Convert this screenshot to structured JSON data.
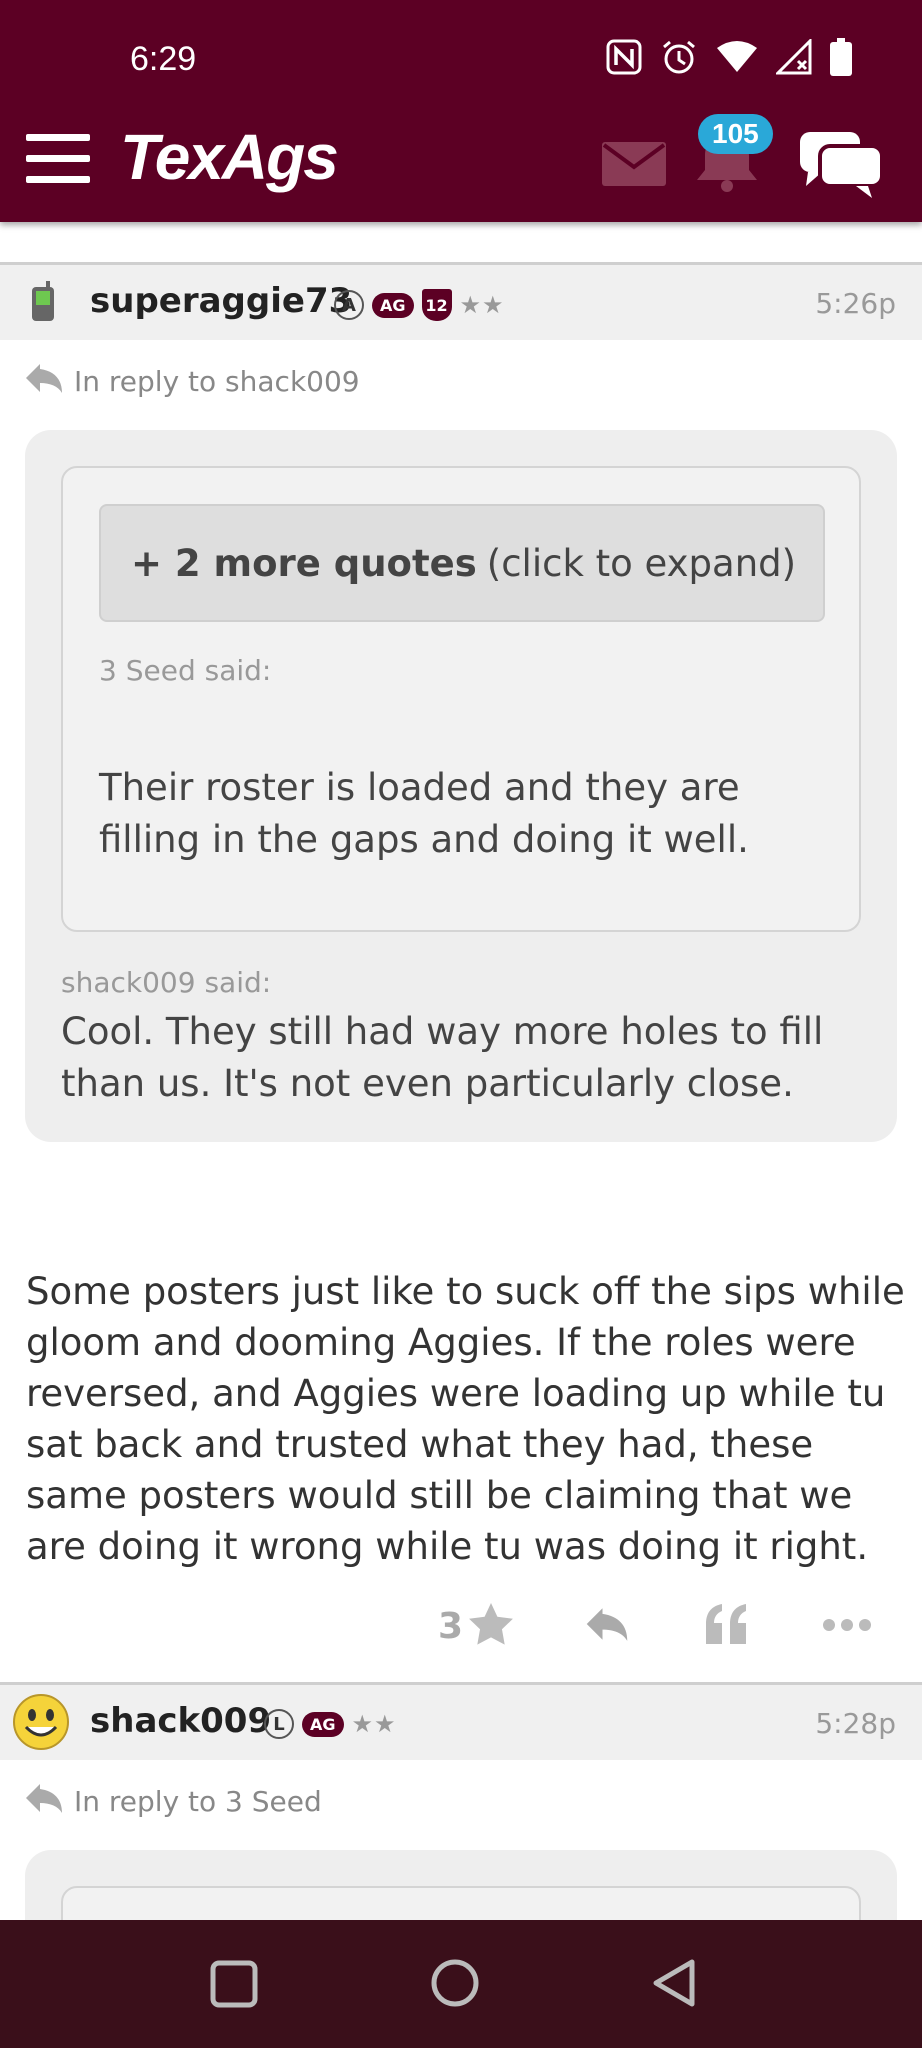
{
  "status_bar": {
    "time": "6:29"
  },
  "header": {
    "logo": "TexAgs",
    "notification_count": "105"
  },
  "posts": [
    {
      "user": "superaggie73",
      "badges": [
        "A",
        "AG",
        "12"
      ],
      "time": "5:26p",
      "reply_to": "In reply to shack009",
      "expand": {
        "bold": "+ 2 more quotes",
        "rest": "(click to expand)"
      },
      "inner_quote": {
        "author": "3 Seed said:",
        "text": "Their roster is loaded and they are filling in the gaps and doing it well."
      },
      "outer_quote": {
        "author": "shack009 said:",
        "text": "Cool. They still had way more holes to fill than us. It's not even particularly close."
      },
      "body": "Some posters just like to suck off the sips while gloom and dooming Aggies. If the roles were reversed, and Aggies were loading up while tu sat back and trusted what they had, these same posters would still be claiming that we are doing it wrong while tu was doing it right.",
      "star_count": "3"
    },
    {
      "user": "shack009",
      "badges": [
        "L",
        "AG"
      ],
      "time": "5:28p",
      "reply_to": "In reply to 3 Seed"
    }
  ],
  "colors": {
    "maroon": "#5c0024",
    "badge_blue": "#2aa8d8",
    "nav_bg": "#3a0f1a"
  }
}
